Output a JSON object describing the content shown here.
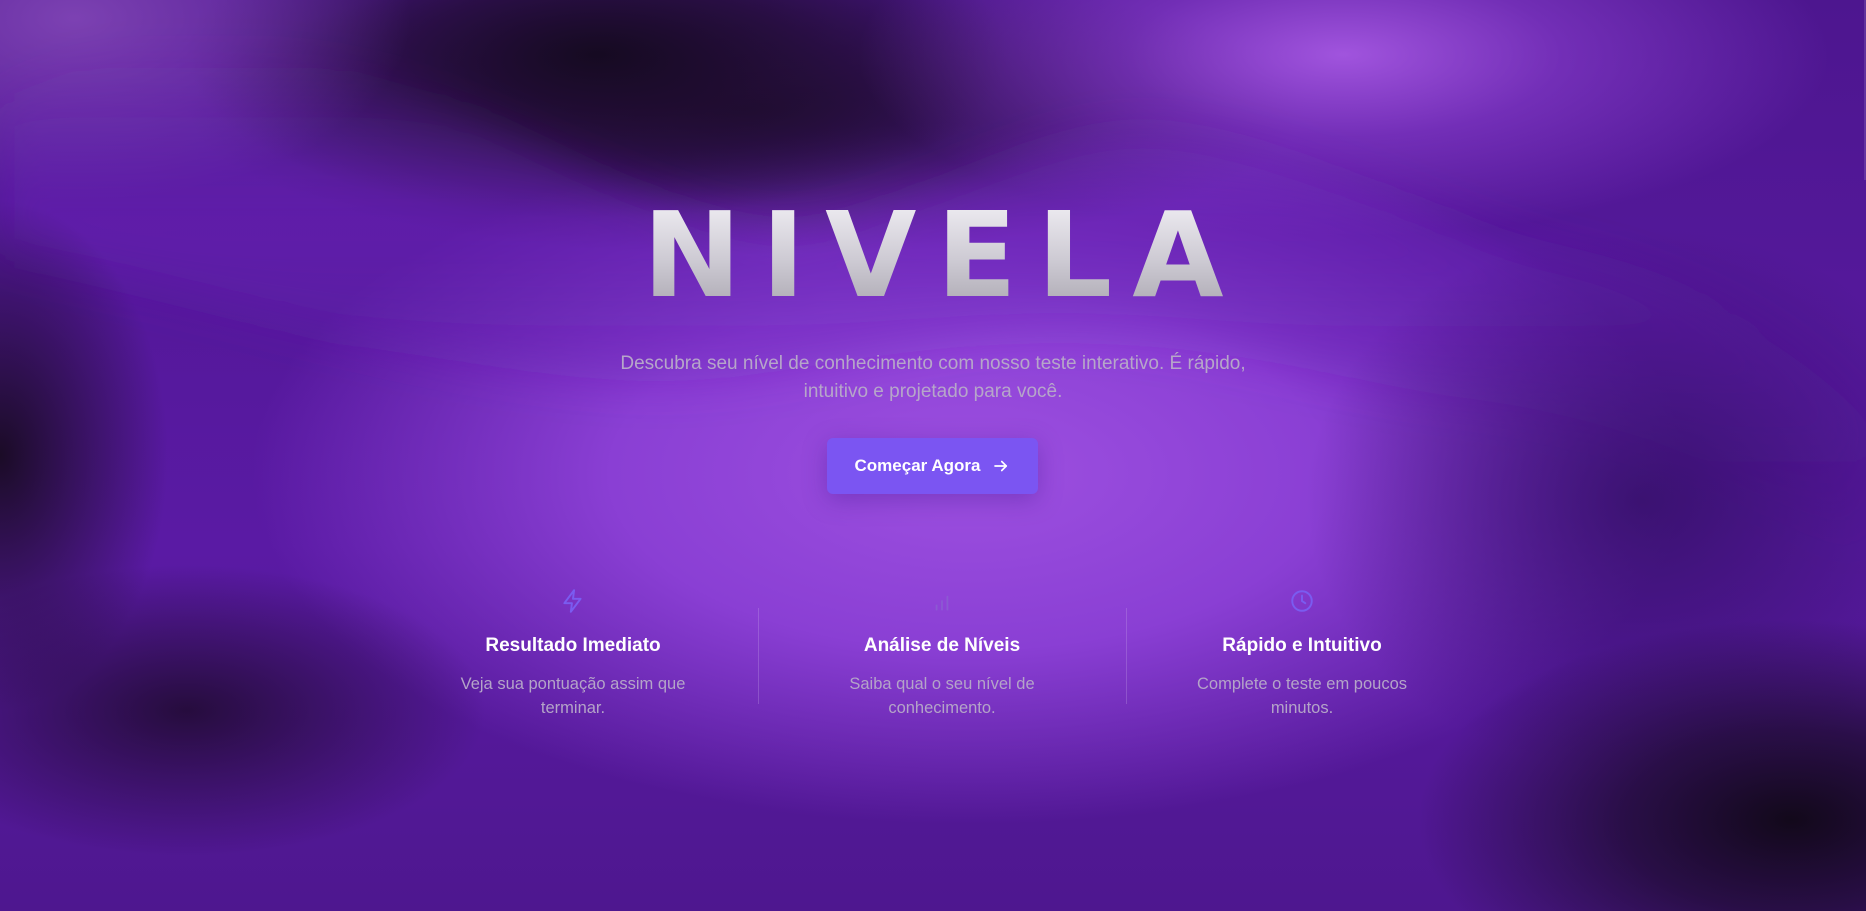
{
  "hero": {
    "logo_text": "NIVELA",
    "subtitle_line1": "Descubra seu nível de conhecimento com nosso teste interativo. É rápido,",
    "subtitle_line2": "intuitivo e projetado para você.",
    "cta_label": "Começar Agora",
    "cta_icon": "arrow-right-icon"
  },
  "features": [
    {
      "icon": "lightning-icon",
      "title": "Resultado Imediato",
      "description_line1": "Veja sua pontuação assim que",
      "description_line2": "terminar."
    },
    {
      "icon": "bar-chart-icon",
      "title": "Análise de Níveis",
      "description_line1": "Saiba qual o seu nível de",
      "description_line2": "conhecimento."
    },
    {
      "icon": "clock-icon",
      "title": "Rápido e Intuitivo",
      "description_line1": "Complete o teste em poucos",
      "description_line2": "minutos."
    }
  ],
  "colors": {
    "accent": "#7b55f2",
    "icon_accent": "#7a5cf0",
    "background_primary": "#5a1ba0",
    "background_light": "#9d50e0",
    "text_muted": "#b6a6c9",
    "text_heading": "#ffffff"
  }
}
